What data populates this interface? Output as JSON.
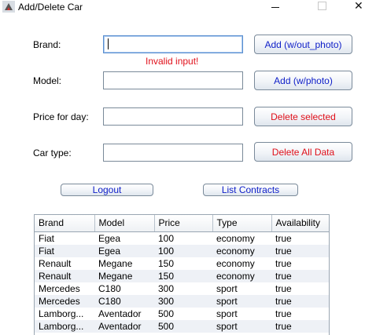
{
  "window": {
    "title": "Add/Delete Car"
  },
  "form": {
    "brand_label": "Brand:",
    "brand_value": "",
    "error_text": "Invalid input!",
    "model_label": "Model:",
    "model_value": "",
    "price_label": "Price for day:",
    "price_value": "",
    "type_label": "Car type:",
    "type_value": ""
  },
  "buttons": {
    "add_no_photo": "Add (w/out_photo)",
    "add_photo": "Add (w/photo)",
    "delete_selected": "Delete selected",
    "delete_all": "Delete All Data",
    "logout": "Logout",
    "list_contracts": "List Contracts"
  },
  "colors": {
    "error": "#e0101a",
    "blue_text": "#1020c8",
    "focus_border": "#5a8fd0"
  },
  "table": {
    "headers": [
      "Brand",
      "Model",
      "Price",
      "Type",
      "Availability"
    ],
    "rows": [
      [
        "Fiat",
        "Egea",
        "100",
        "economy",
        "true"
      ],
      [
        "Fiat",
        "Egea",
        "100",
        "economy",
        "true"
      ],
      [
        "Renault",
        "Megane",
        "150",
        "economy",
        "true"
      ],
      [
        "Renault",
        "Megane",
        "150",
        "economy",
        "true"
      ],
      [
        "Mercedes",
        "C180",
        "300",
        "sport",
        "true"
      ],
      [
        "Mercedes",
        "C180",
        "300",
        "sport",
        "true"
      ],
      [
        "Lamborg...",
        "Aventador",
        "500",
        "sport",
        "true"
      ],
      [
        "Lamborg...",
        "Aventador",
        "500",
        "sport",
        "true"
      ]
    ]
  }
}
